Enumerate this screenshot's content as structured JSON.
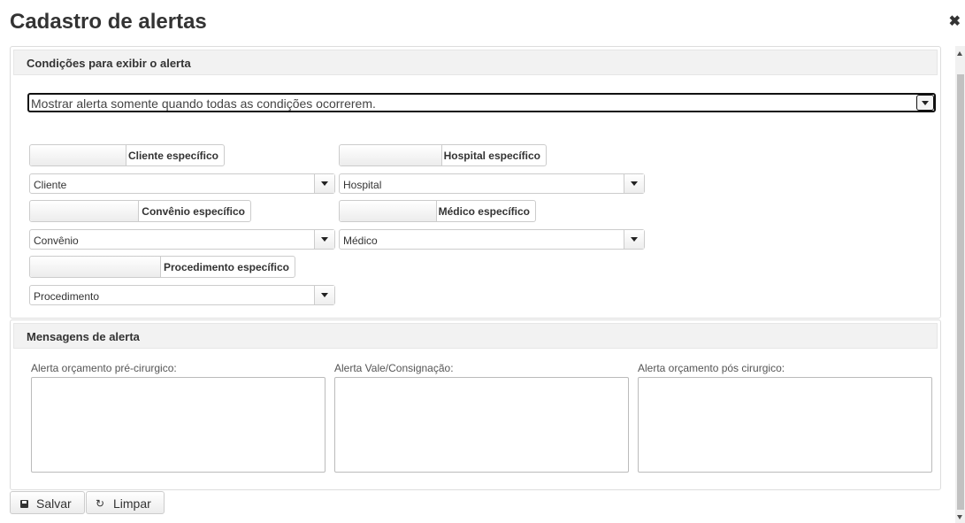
{
  "dialog": {
    "title": "Cadastro de alertas",
    "close_glyph": "✖"
  },
  "conditions": {
    "header": "Condições para exibir o alerta",
    "mode_value": "Mostrar alerta somente quando todas as condições ocorrerem.",
    "toggles": {
      "cliente": "Cliente específico",
      "hospital": "Hospital específico",
      "convenio": "Convênio específico",
      "medico": "Médico específico",
      "procedimento": "Procedimento específico"
    },
    "selects": {
      "cliente": "Cliente",
      "hospital": "Hospital",
      "convenio": "Convênio",
      "medico": "Médico",
      "procedimento": "Procedimento"
    }
  },
  "messages": {
    "header": "Mensagens de alerta",
    "pre_label": "Alerta orçamento pré-cirurgico:",
    "vale_label": "Alerta Vale/Consignação:",
    "pos_label": "Alerta orçamento pós cirurgico:",
    "pre_value": "",
    "vale_value": "",
    "pos_value": ""
  },
  "actions": {
    "save_label": "Salvar",
    "clear_label": "Limpar",
    "clear_icon_glyph": "↻"
  },
  "icons": {
    "close": "close-icon",
    "save": "floppy-disk-icon",
    "clear": "refresh-icon",
    "dropdown": "caret-down-icon"
  }
}
